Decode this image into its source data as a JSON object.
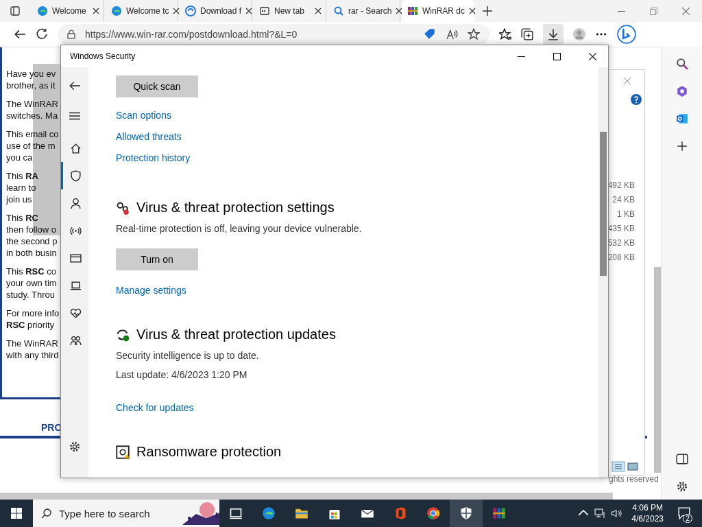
{
  "browser": {
    "tabs": [
      {
        "title": "Welcome",
        "selected": false
      },
      {
        "title": "Welcome tc",
        "selected": false
      },
      {
        "title": "Download f",
        "selected": false
      },
      {
        "title": "New tab",
        "selected": false
      },
      {
        "title": "rar - Search",
        "selected": false
      },
      {
        "title": "WinRAR dc",
        "selected": true
      }
    ],
    "address": "https://www.win-rar.com/postdownload.html?&L=0"
  },
  "page": {
    "paragraphs": [
      [
        "Have you ev",
        "brother, as it"
      ],
      [
        "The WinRAR",
        "switches. Ma"
      ],
      [
        "This email co",
        "use of the m",
        "you ca"
      ],
      [
        "This **RA**",
        "learn to",
        "join us"
      ],
      [
        "This **RC**",
        "then follow o",
        "the second p",
        "in both busin"
      ],
      [
        "This **RSC** co",
        "your own tim",
        "study. Throu"
      ],
      [
        "For more info",
        "**RSC** priority"
      ],
      [
        "The WinRAR",
        "with any third"
      ]
    ],
    "footer_link": "PRO",
    "dialog_sizes": [
      "492 KB",
      "24 KB",
      "1 KB",
      "435 KB",
      "532 KB",
      "208 KB"
    ],
    "copyright": "ghts reserved"
  },
  "security": {
    "title": "Windows Security",
    "nav": [
      {
        "selected": false
      },
      {
        "selected": true
      },
      {
        "selected": false
      },
      {
        "selected": false
      },
      {
        "selected": false
      },
      {
        "selected": false
      },
      {
        "selected": false
      },
      {
        "selected": false
      }
    ],
    "quick_scan": "Quick scan",
    "links": [
      "Scan options",
      "Allowed threats",
      "Protection history"
    ],
    "sections": [
      {
        "title": "Virus & threat protection settings",
        "lines": [
          "Real-time protection is off, leaving your device vulnerable."
        ],
        "button": "Turn on",
        "link": "Manage settings"
      },
      {
        "title": "Virus & threat protection updates",
        "lines": [
          "Security intelligence is up to date.",
          "Last update: 4/6/2023 1:20 PM"
        ],
        "link": "Check for updates"
      },
      {
        "title": "Ransomware protection"
      }
    ]
  },
  "taskbar": {
    "search_placeholder": "Type here to search",
    "apps": [
      {
        "selected": false
      },
      {
        "selected": false
      },
      {
        "selected": false
      },
      {
        "selected": false
      },
      {
        "selected": false
      },
      {
        "selected": false
      },
      {
        "selected": false
      },
      {
        "selected": true
      },
      {
        "selected": false
      }
    ],
    "time": "4:06 PM",
    "date": "4/6/2023",
    "notifications": "2"
  }
}
